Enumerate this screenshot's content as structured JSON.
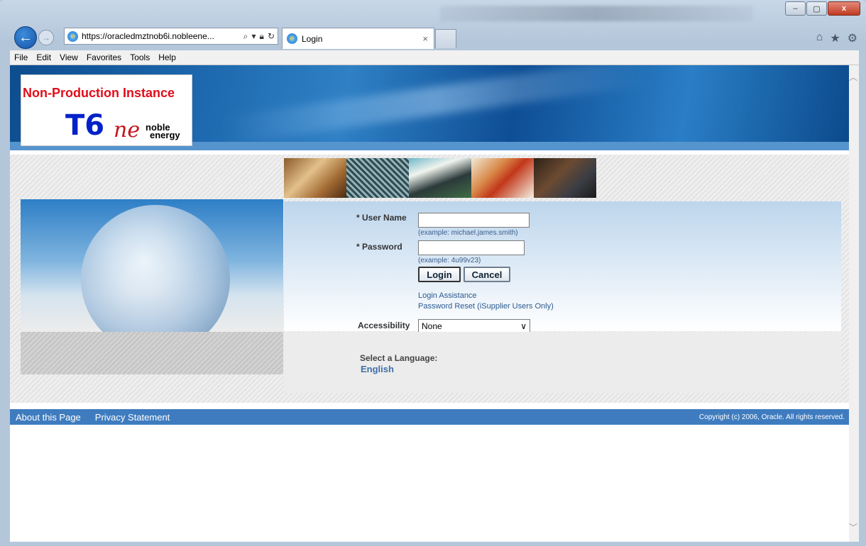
{
  "browser": {
    "address": "https://oracledmztnob6i.nobleene...",
    "tab_title": "Login",
    "window_controls": [
      "–",
      "▢",
      "x"
    ]
  },
  "menu": {
    "items": [
      "File",
      "Edit",
      "View",
      "Favorites",
      "Tools",
      "Help"
    ]
  },
  "banner": {
    "instance_label": "Non-Production Instance",
    "instance_code": "T6",
    "logo_mark": "ne",
    "logo_text_1": "noble",
    "logo_text_2": "energy"
  },
  "form": {
    "username_label": "* User Name",
    "username_value": "",
    "username_hint": "(example: michael.james.smith)",
    "password_label": "* Password",
    "password_value": "",
    "password_hint": "(example: 4u99v23)",
    "login_button": "Login",
    "cancel_button": "Cancel",
    "login_assistance": "Login Assistance",
    "password_reset": "Password Reset (iSupplier Users Only)",
    "accessibility_label": "Accessibility",
    "accessibility_value": "None"
  },
  "language": {
    "label": "Select a Language:",
    "english": "English"
  },
  "footer": {
    "about": "About this Page",
    "privacy": "Privacy Statement",
    "copyright": "Copyright (c) 2006, Oracle. All rights reserved."
  },
  "colors": {
    "banner_blue": "#1a64aa",
    "footer_blue": "#3f7cbf",
    "link_blue": "#2b5a8f",
    "instance_red": "#e00d1a",
    "instance_code_blue": "#0022c8"
  }
}
